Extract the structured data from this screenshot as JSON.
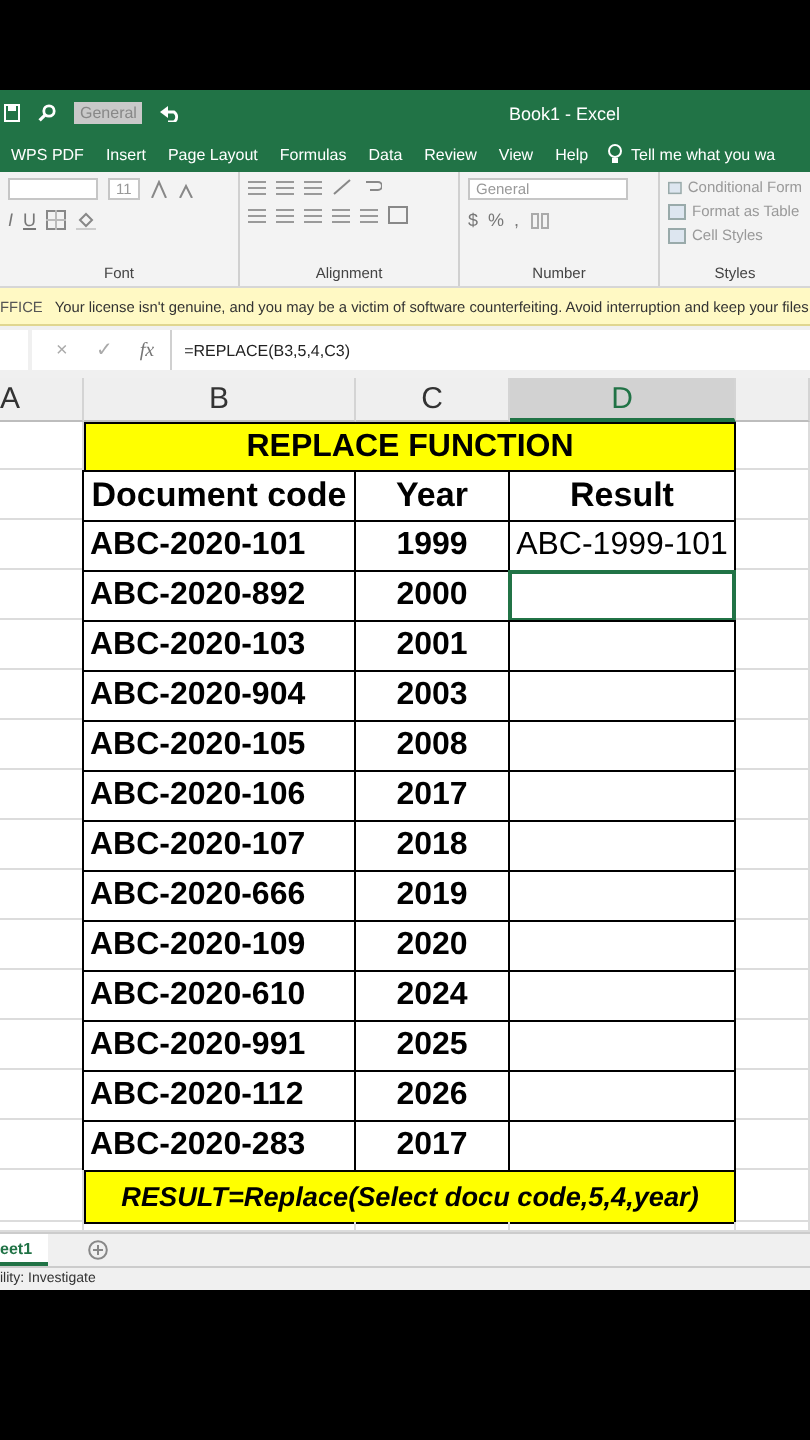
{
  "title_bar": {
    "quick_format": "General",
    "title": "Book1 - Excel"
  },
  "ribbon_tabs": [
    {
      "label": "WPS PDF",
      "selected": false
    },
    {
      "label": "Insert",
      "selected": false
    },
    {
      "label": "Page Layout",
      "selected": false
    },
    {
      "label": "Formulas",
      "selected": false
    },
    {
      "label": "Data",
      "selected": false
    },
    {
      "label": "Review",
      "selected": false
    },
    {
      "label": "View",
      "selected": false
    },
    {
      "label": "Help",
      "selected": false
    }
  ],
  "tell_me": "Tell me what you wa",
  "ribbon": {
    "font": {
      "size": "11",
      "buttons": [
        "I",
        "U"
      ],
      "label": "Font"
    },
    "alignment": {
      "label": "Alignment"
    },
    "number": {
      "format": "General",
      "buttons": [
        "$",
        "%",
        ","
      ],
      "label": "Number"
    },
    "styles": {
      "items": [
        "Conditional Form",
        "Format as Table",
        "Cell Styles"
      ],
      "label": "Styles"
    }
  },
  "notice": {
    "tag": "FFICE",
    "message": "Your license isn't genuine, and you may be a victim of software counterfeiting. Avoid interruption and keep your files"
  },
  "formula_bar": {
    "cancel": "×",
    "enter": "✓",
    "function": "fx",
    "formula": "=REPLACE(B3,5,4,C3)"
  },
  "columns": [
    {
      "label": "A",
      "selected": false
    },
    {
      "label": "B",
      "selected": false
    },
    {
      "label": "C",
      "selected": false
    },
    {
      "label": "D",
      "selected": true
    }
  ],
  "table": {
    "title": "REPLACE FUNCTION",
    "headers": [
      "Document code",
      "Year",
      "Result"
    ],
    "rows": [
      {
        "code": "ABC-2020-101",
        "year": "1999",
        "result": "ABC-1999-101",
        "selected": false
      },
      {
        "code": "ABC-2020-892",
        "year": "2000",
        "selected": true
      },
      {
        "code": "ABC-2020-103",
        "year": "2001",
        "selected": false
      },
      {
        "code": "ABC-2020-904",
        "year": "2003",
        "selected": false
      },
      {
        "code": "ABC-2020-105",
        "year": "2008",
        "selected": false
      },
      {
        "code": "ABC-2020-106",
        "year": "2017",
        "selected": false
      },
      {
        "code": "ABC-2020-107",
        "year": "2018",
        "selected": false
      },
      {
        "code": "ABC-2020-666",
        "year": "2019",
        "selected": false
      },
      {
        "code": "ABC-2020-109",
        "year": "2020",
        "selected": false
      },
      {
        "code": "ABC-2020-610",
        "year": "2024",
        "selected": false
      },
      {
        "code": "ABC-2020-991",
        "year": "2025",
        "selected": false
      },
      {
        "code": "ABC-2020-112",
        "year": "2026",
        "selected": false
      },
      {
        "code": "ABC-2020-283",
        "year": "2017",
        "selected": false
      }
    ],
    "footer": "RESULT=Replace(Select docu code,5,4,year)"
  },
  "sheet_tabs": [
    {
      "label": "eet1",
      "selected": true
    }
  ],
  "status": "ility: Investigate"
}
